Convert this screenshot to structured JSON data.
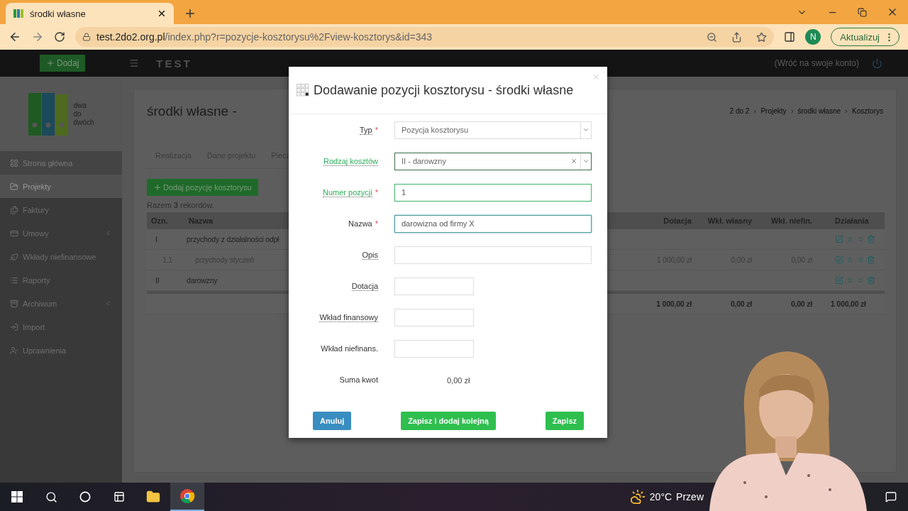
{
  "browser": {
    "tab_title": "środki własne",
    "url_host": "test.2do2.org.pl",
    "url_path": "/index.php?r=pozycje-kosztorysu%2Fview-kosztorys&id=343",
    "profile_initial": "N",
    "update_button": "Aktualizuj"
  },
  "header": {
    "add_button": "Dodaj",
    "brand": "TEST",
    "back_link": "(Wróć na swoje konto)"
  },
  "logo": {
    "lines": [
      "dwa",
      "do",
      "dwóch"
    ]
  },
  "sidebar": {
    "items": [
      {
        "label": "Strona główna",
        "selected": false,
        "submenu": false
      },
      {
        "label": "Projekty",
        "selected": true,
        "submenu": false
      },
      {
        "label": "Faktury",
        "selected": false,
        "submenu": false
      },
      {
        "label": "Umowy",
        "selected": false,
        "submenu": true
      },
      {
        "label": "Wkłady niefinansowe",
        "selected": false,
        "submenu": false
      },
      {
        "label": "Raporty",
        "selected": false,
        "submenu": false
      },
      {
        "label": "Archiwum",
        "selected": false,
        "submenu": true
      },
      {
        "label": "Import",
        "selected": false,
        "submenu": false
      },
      {
        "label": "Uprawnienia",
        "selected": false,
        "submenu": false
      }
    ]
  },
  "page": {
    "title": "środki własne -",
    "breadcrumb": [
      "2 do 2",
      "Projekty",
      "środki własne",
      "Kosztorys"
    ],
    "tabs": [
      "Realizacja",
      "Dane projektu",
      "Piecz"
    ],
    "add_button": "Dodaj pozycję kosztorysu",
    "records": "Razem **3** rekordów."
  },
  "table": {
    "columns": [
      "Ozn.",
      "Nazwa",
      "Dotacja",
      "Wkł. własny",
      "Wkł. niefin.",
      "Działania"
    ],
    "rows": [
      {
        "mark": "I",
        "name": "przychody z działalności odpł",
        "children": [
          {
            "mark": "1.1",
            "name": "przychody styczeń",
            "dotacja": "1 000,00 zł",
            "wlasny": "0,00 zł",
            "niefin": "0,00 zł"
          }
        ]
      },
      {
        "mark": "II",
        "name": "darowzny"
      }
    ],
    "totals": [
      "1 000,00 zł",
      "0,00 zł",
      "0,00 zł",
      "1 000,00 zł"
    ]
  },
  "modal": {
    "title": "Dodawanie pozycji kosztorysu - środki własne",
    "required_mark": "*",
    "fields": [
      {
        "kind": "select",
        "label": "Typ",
        "required": true,
        "hint": true,
        "valid": false,
        "focused": false,
        "value": "Pozycja kosztorysu",
        "clearable": false
      },
      {
        "kind": "select",
        "label": "Rodzaj kosztów",
        "required": false,
        "hint": true,
        "valid": true,
        "focused": false,
        "value": "II - darowzny",
        "clearable": true
      },
      {
        "kind": "text",
        "label": "Numer pozycji",
        "required": true,
        "hint": true,
        "valid": true,
        "focused": false,
        "value": "1"
      },
      {
        "kind": "text",
        "label": "Nazwa",
        "required": true,
        "hint": false,
        "valid": false,
        "focused": true,
        "value": "darowizna od firmy X"
      },
      {
        "kind": "text",
        "label": "Opis",
        "required": false,
        "hint": true,
        "valid": false,
        "focused": false
      },
      {
        "kind": "short",
        "label": "Dotacja",
        "required": false,
        "hint": true,
        "valid": false,
        "focused": false
      },
      {
        "kind": "short",
        "label": "Wkład finansowy",
        "required": false,
        "hint": true,
        "valid": false,
        "focused": false
      },
      {
        "kind": "short",
        "label": "Wkład niefinans.",
        "required": false,
        "hint": false,
        "valid": false,
        "focused": false
      },
      {
        "kind": "sum",
        "label": "Suma kwot",
        "value": "0,00 zł"
      }
    ],
    "buttons": [
      {
        "label": "Anuluj",
        "kind": "cancel"
      },
      {
        "label": "Zapisz i dodaj kolejną",
        "kind": "save"
      },
      {
        "label": "Zapisz",
        "kind": "save"
      }
    ]
  },
  "taskbar": {
    "temperature": "20°C",
    "weather_text": "Przew"
  }
}
